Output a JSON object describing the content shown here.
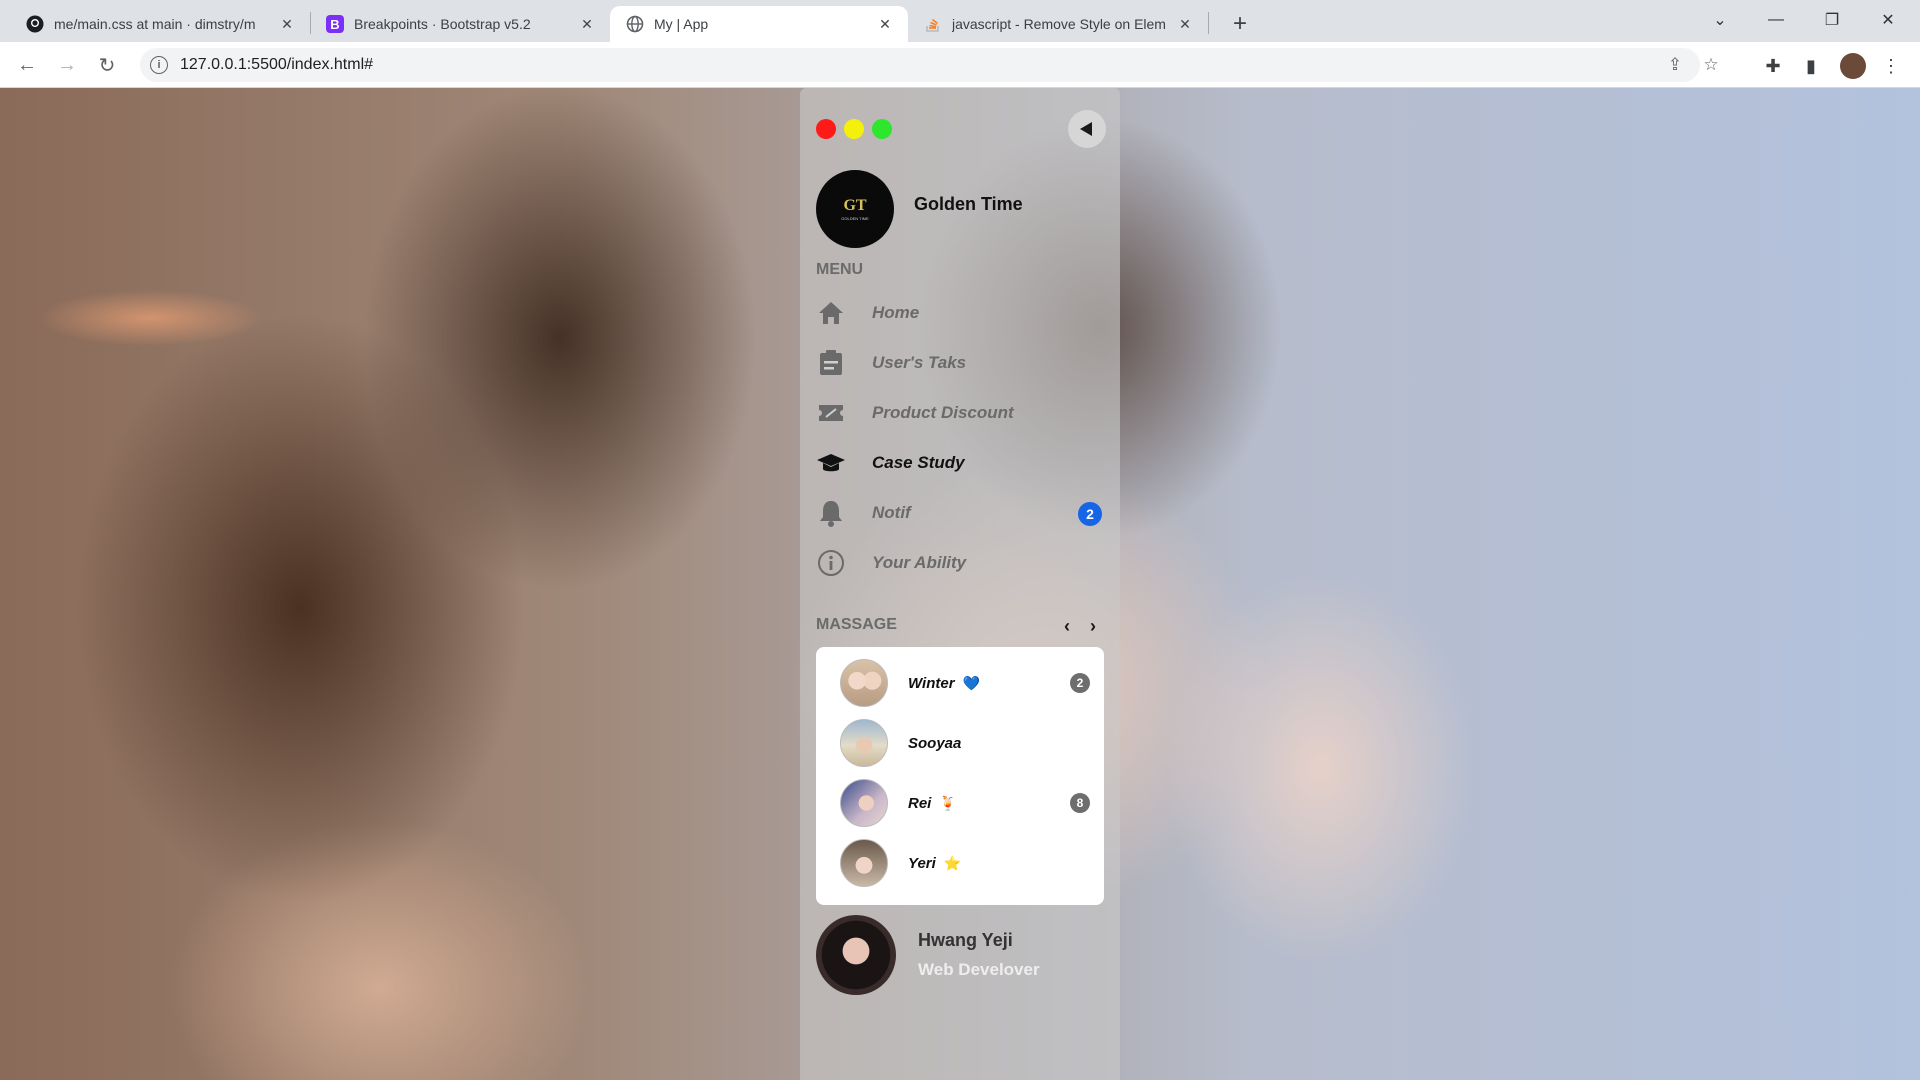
{
  "browser": {
    "tabs": [
      {
        "title": "me/main.css at main · dimstry/m",
        "favicon": "github-icon"
      },
      {
        "title": "Breakpoints · Bootstrap v5.2",
        "favicon": "bootstrap-icon",
        "favicon_letter": "B",
        "favicon_color": "#7b2ff7"
      },
      {
        "title": "My | App",
        "favicon": "globe-icon"
      },
      {
        "title": "javascript - Remove Style on Elem",
        "favicon": "stackoverflow-icon"
      }
    ],
    "url": "127.0.0.1:5500/index.html#"
  },
  "sidebar": {
    "traffic_lights": [
      "#ff1a1a",
      "#f5f00a",
      "#2ee62e"
    ],
    "brand": {
      "name": "Golden Time",
      "logo_mono": "GT",
      "logo_text": "GOLDEN TIME"
    },
    "menu_label": "MENU",
    "menu": [
      {
        "label": "Home",
        "icon": "home-icon"
      },
      {
        "label": "User's Taks",
        "icon": "clipboard-icon"
      },
      {
        "label": "Product Discount",
        "icon": "ticket-icon"
      },
      {
        "label": "Case Study",
        "icon": "graduation-cap-icon",
        "active": true
      },
      {
        "label": "Notif",
        "icon": "bell-icon",
        "badge": "2"
      },
      {
        "label": "Your Ability",
        "icon": "info-icon"
      }
    ],
    "messages_label": "MASSAGE",
    "messages": [
      {
        "name": "Winter",
        "emoji": "💙",
        "badge": "2"
      },
      {
        "name": "Sooyaa",
        "emoji": "",
        "badge": ""
      },
      {
        "name": "Rei",
        "emoji": "🍹",
        "badge": "8"
      },
      {
        "name": "Yeri",
        "emoji": "⭐",
        "badge": ""
      }
    ],
    "profile": {
      "name": "Hwang Yeji",
      "role": "Web Develover"
    }
  }
}
